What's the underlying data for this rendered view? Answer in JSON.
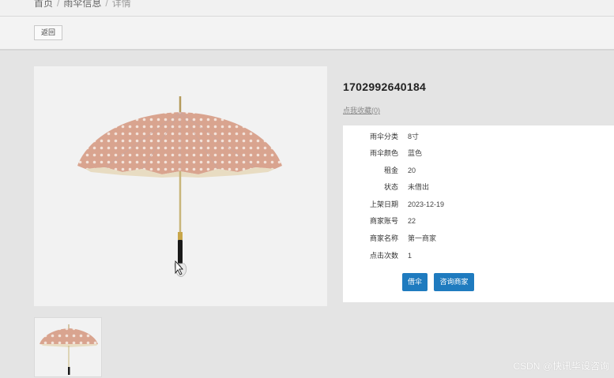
{
  "breadcrumb": {
    "home": "首页",
    "section": "雨伞信息",
    "current": "详情",
    "separator": "/"
  },
  "toolbar": {
    "back_label": "返回"
  },
  "product": {
    "title": "1702992640184",
    "favorite_label": "点我收藏(0)",
    "fields": [
      {
        "label": "雨伞分类",
        "value": "8寸"
      },
      {
        "label": "雨伞颜色",
        "value": "蓝色"
      },
      {
        "label": "租金",
        "value": "20"
      },
      {
        "label": "状态",
        "value": "未借出"
      },
      {
        "label": "上架日期",
        "value": "2023-12-19"
      },
      {
        "label": "商家账号",
        "value": "22"
      },
      {
        "label": "商家名称",
        "value": "第一商家"
      },
      {
        "label": "点击次数",
        "value": "1"
      }
    ]
  },
  "actions": {
    "borrow_label": "借伞",
    "consult_label": "咨询商家"
  },
  "image": {
    "icon": "umbrella-image",
    "canopy_color": "#d9a48f",
    "dot_color": "#f3e3da"
  },
  "watermark": "CSDN @快讯毕设咨询",
  "colors": {
    "accent": "#1f7bbf",
    "page_bg": "#e4e4e4"
  }
}
